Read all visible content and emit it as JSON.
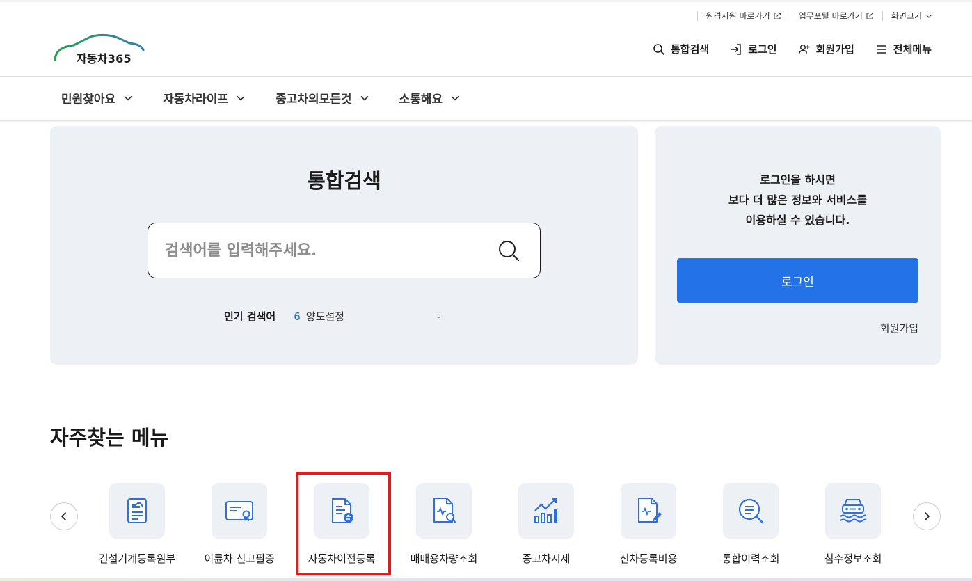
{
  "util": {
    "remote_support": "원격지원 바로가기",
    "work_portal": "업무포털 바로가기",
    "screen_size": "화면크기"
  },
  "logo": {
    "text": "자동차365"
  },
  "header": {
    "search": "통합검색",
    "login": "로그인",
    "signup": "회원가입",
    "all_menu": "전체메뉴"
  },
  "gnb": [
    {
      "label": "민원찾아요"
    },
    {
      "label": "자동차라이프"
    },
    {
      "label": "중고차의모든것"
    },
    {
      "label": "소통해요"
    }
  ],
  "search": {
    "title": "통합검색",
    "placeholder": "검색어를 입력해주세요.",
    "popular_label": "인기 검색어",
    "popular_rank": "6",
    "popular_word": "양도설정",
    "popular_change": "-"
  },
  "login_panel": {
    "line1": "로그인을 하시면",
    "line2": "보다 더 많은 정보와 서비스를",
    "line3": "이용하실 수 있습니다.",
    "button": "로그인",
    "join": "회원가입"
  },
  "frequent": {
    "title": "자주찾는 메뉴",
    "items": [
      {
        "label": "건설기계등록원부",
        "icon": "construction-register-icon"
      },
      {
        "label": "이륜차 신고필증",
        "icon": "certificate-icon"
      },
      {
        "label": "자동차이전등록",
        "icon": "transfer-document-icon"
      },
      {
        "label": "매매용차량조회",
        "icon": "document-search-icon"
      },
      {
        "label": "중고차시세",
        "icon": "chart-trend-icon"
      },
      {
        "label": "신차등록비용",
        "icon": "document-edit-icon"
      },
      {
        "label": "통합이력조회",
        "icon": "magnifier-icon"
      },
      {
        "label": "침수정보조회",
        "icon": "flood-car-icon"
      }
    ]
  },
  "colors": {
    "accent": "#2372e8",
    "panel": "#edf0f4",
    "highlight": "#e21b1b",
    "icon": "#2f6fe0"
  }
}
